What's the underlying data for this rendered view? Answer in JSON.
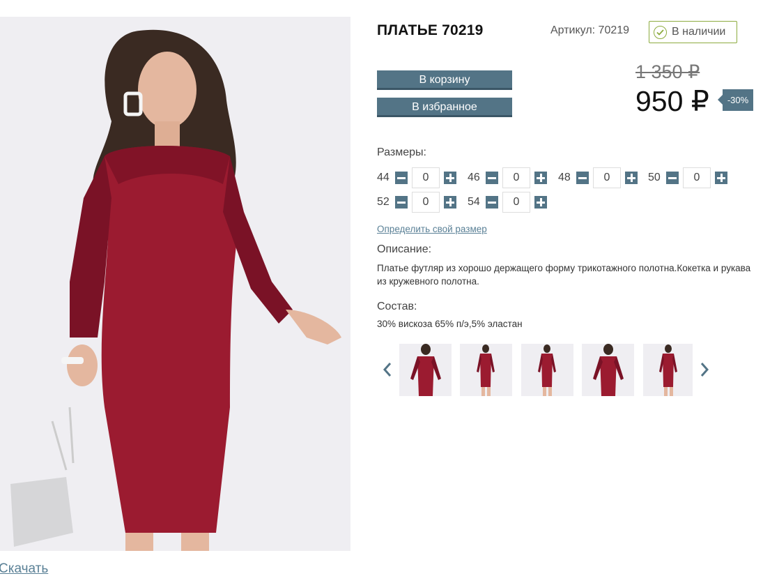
{
  "product": {
    "title": "ПЛАТЬЕ 70219",
    "article_label": "Артикул:",
    "article_value": "70219",
    "stock_status": "В наличии"
  },
  "buttons": {
    "cart": "В корзину",
    "favorites": "В избранное"
  },
  "price": {
    "old": "1 350 ₽",
    "new": "950 ₽",
    "discount": "-30%"
  },
  "sizes": {
    "label": "Размеры:",
    "items": [
      {
        "size": "44",
        "qty": "0"
      },
      {
        "size": "46",
        "qty": "0"
      },
      {
        "size": "48",
        "qty": "0"
      },
      {
        "size": "50",
        "qty": "0"
      },
      {
        "size": "52",
        "qty": "0"
      },
      {
        "size": "54",
        "qty": "0"
      }
    ],
    "find_size_link": "Определить свой размер"
  },
  "description": {
    "label": "Описание:",
    "text": "Платье футляр из хорошо держащего форму трикотажного полотна.Кокетка и рукава из кружевного полотна."
  },
  "composition": {
    "label": "Состав:",
    "text": "30% вискоза 65% п/э,5% эластан"
  },
  "gallery": {
    "prev_icon": "chevron-left-icon",
    "next_icon": "chevron-right-icon",
    "thumbnail_count": 5
  },
  "download_link": "Скачать",
  "colors": {
    "accent": "#537486",
    "stock_green": "#8cab3e",
    "link": "#5a8096",
    "dress": "#9b1b30"
  }
}
